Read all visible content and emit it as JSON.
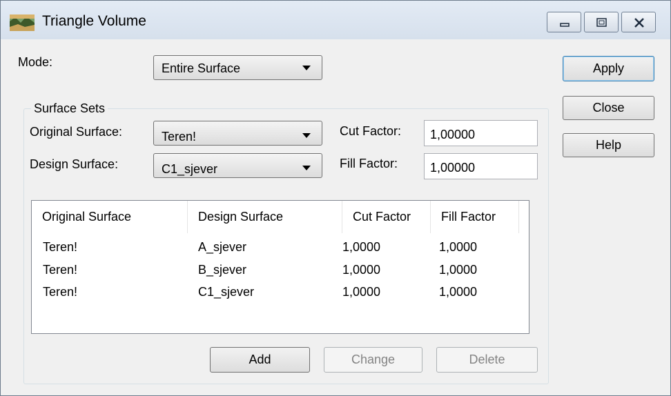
{
  "window": {
    "title": "Triangle Volume",
    "icon": "terrain-app-icon",
    "controls": [
      "minimize-icon",
      "restore-icon",
      "close-icon"
    ]
  },
  "mode": {
    "label": "Mode:",
    "value": "Entire Surface"
  },
  "surface_sets": {
    "title": "Surface Sets",
    "original_label": "Original Surface:",
    "original_value": "Teren!",
    "design_label": "Design Surface:",
    "design_value": "C1_sjever",
    "cut_label": "Cut Factor:",
    "cut_value": "1,00000",
    "fill_label": "Fill Factor:",
    "fill_value": "1,00000"
  },
  "table": {
    "headers": [
      "Original Surface",
      "Design Surface",
      "Cut Factor",
      "Fill Factor"
    ],
    "rows": [
      [
        "Teren!",
        "A_sjever",
        "1,0000",
        "1,0000"
      ],
      [
        "Teren!",
        "B_sjever",
        "1,0000",
        "1,0000"
      ],
      [
        "Teren!",
        "C1_sjever",
        "1,0000",
        "1,0000"
      ]
    ]
  },
  "buttons": {
    "apply": "Apply",
    "close": "Close",
    "help": "Help",
    "add": "Add",
    "change": "Change",
    "delete": "Delete"
  }
}
